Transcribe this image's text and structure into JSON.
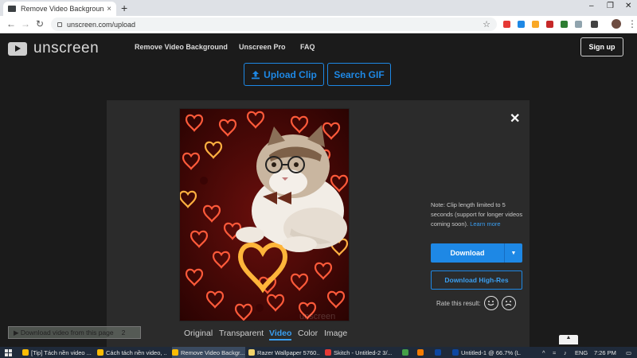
{
  "browser": {
    "tab_title": "Remove Video Background – Un",
    "tab_close": "×",
    "new_tab": "+",
    "url": "unscreen.com/upload",
    "win_min": "–",
    "win_max": "❐",
    "win_close": "✕"
  },
  "site": {
    "logo_text": "unscreen",
    "nav": [
      "Remove Video Background",
      "Unscreen Pro",
      "FAQ"
    ],
    "signup": "Sign up",
    "upload_clip": "Upload Clip",
    "search_gif": "Search GIF"
  },
  "dialog": {
    "close": "✕",
    "note_text": "Note: Clip length limited to 5 seconds (support for longer videos coming soon).",
    "learn_more": "Learn more",
    "download": "Download",
    "download_caret": "▼",
    "download_hires": "Download High-Res",
    "rate_label": "Rate this result:",
    "modes": [
      "Original",
      "Transparent",
      "Video",
      "Color",
      "Image"
    ],
    "active_mode": "Video",
    "watermark": "unscreen"
  },
  "overlay": {
    "download_bar": "▶ Download video from this page",
    "download_bar_badge": "2",
    "scroll_up": "▲"
  },
  "taskbar": {
    "items": [
      "[Tip] Tách nền video ...",
      "Cách tách nền video, ...",
      "Remove Video Backgr...",
      "Razer Wallpaper 5760...",
      "Skitch - Untitled-2 3/...",
      "Untitled-1 @ 66.7% (L..."
    ],
    "lang": "ENG",
    "time": "7:26 PM"
  },
  "colors": {
    "accent": "#1e88e5",
    "panel": "#2b2b2b",
    "page_bg": "#1b1b1b"
  }
}
